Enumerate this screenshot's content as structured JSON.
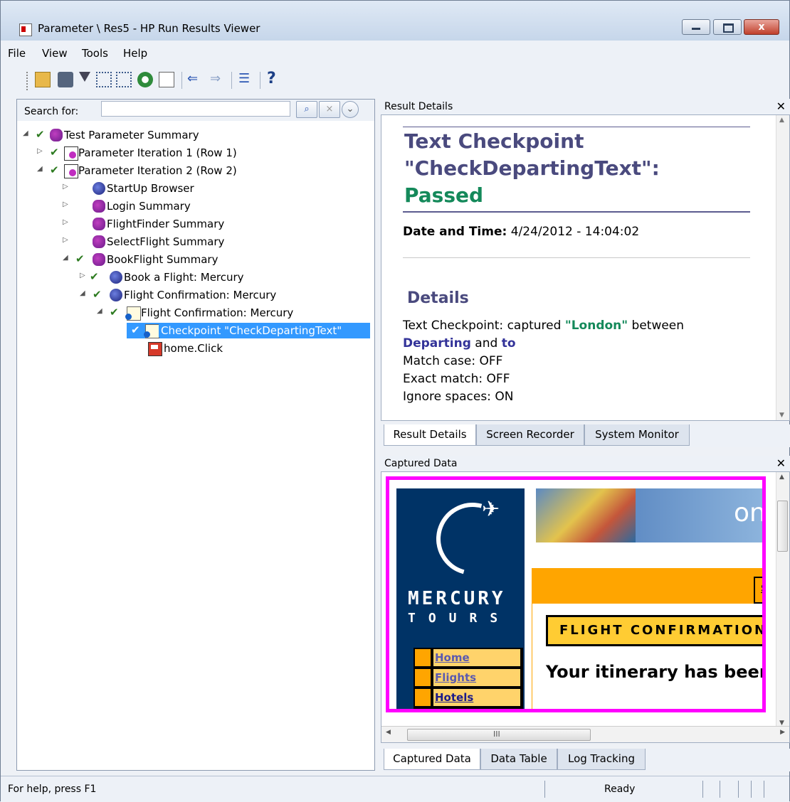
{
  "window": {
    "title": "Parameter \\ Res5 - HP Run Results Viewer",
    "close_glyph": "x"
  },
  "menu": [
    "File",
    "View",
    "Tools",
    "Help"
  ],
  "toolbar": {
    "icons": [
      "open-icon",
      "print-icon",
      "filter-icon",
      "expand-all-icon",
      "collapse-all-icon",
      "find-icon",
      "export-icon",
      "back-icon",
      "forward-icon",
      "list-icon",
      "help-icon"
    ]
  },
  "search": {
    "label": "Search for:",
    "value": ""
  },
  "tree": [
    {
      "label": "Test Parameter Summary",
      "icon": "summary-icon",
      "checked": true,
      "expanded": true
    },
    {
      "label": "Parameter Iteration 1 (Row 1)",
      "icon": "iteration-icon",
      "checked": true,
      "expanded": false
    },
    {
      "label": "Parameter Iteration 2 (Row 2)",
      "icon": "iteration-icon",
      "checked": true,
      "expanded": true
    },
    {
      "label": "StartUp Browser",
      "icon": "browser-icon",
      "checked": false,
      "expanded": false
    },
    {
      "label": "Login Summary",
      "icon": "action-summary-icon",
      "checked": false,
      "expanded": false
    },
    {
      "label": "FlightFinder Summary",
      "icon": "action-summary-icon",
      "checked": false,
      "expanded": false
    },
    {
      "label": "SelectFlight Summary",
      "icon": "action-summary-icon",
      "checked": false,
      "expanded": false
    },
    {
      "label": "BookFlight Summary",
      "icon": "action-summary-icon",
      "checked": true,
      "expanded": true
    },
    {
      "label": "Book a Flight: Mercury",
      "icon": "browser-icon",
      "checked": true,
      "expanded": false
    },
    {
      "label": "Flight Confirmation: Mercury",
      "icon": "browser-icon",
      "checked": true,
      "expanded": true
    },
    {
      "label": "Flight Confirmation: Mercury",
      "icon": "page-icon",
      "checked": true,
      "expanded": true
    },
    {
      "label": "Checkpoint \"CheckDepartingText\"",
      "icon": "page-icon",
      "checked": true,
      "selected": true
    },
    {
      "label": "home.Click",
      "icon": "click-icon",
      "checked": false
    }
  ],
  "result_details": {
    "panel_title": "Result Details",
    "title_line1": "Text Checkpoint",
    "title_line2": "\"CheckDepartingText\":",
    "status": "Passed",
    "date_label": "Date and Time:",
    "date_value": "4/24/2012 - 14:04:02",
    "details_heading": "Details",
    "line1_prefix": "Text Checkpoint: captured ",
    "captured": "\"London\"",
    "line1_suffix": " between",
    "departing": "Departing",
    "and_word": " and ",
    "to_word": "to",
    "match_case": "Match case: OFF",
    "exact_match": "Exact match: OFF",
    "ignore_spaces": "Ignore spaces: ON"
  },
  "top_tabs": [
    "Result Details",
    "Screen Recorder",
    "System Monitor"
  ],
  "captured_data": {
    "panel_title": "Captured Data",
    "logo_line1": "MERCURY",
    "logo_line2": "TOURS",
    "banner_text": "on",
    "nav": [
      "Home",
      "Flights",
      "Hotels"
    ],
    "orange_box_letter": "S",
    "confirmation": "FLIGHT CONFIRMATION",
    "itinerary": "Your itinerary has been",
    "scroll_grip": "III",
    "highlight_color": "#ff00ff"
  },
  "bottom_tabs": [
    "Captured Data",
    "Data Table",
    "Log Tracking"
  ],
  "status": {
    "help": "For help, press F1",
    "ready": "Ready"
  }
}
